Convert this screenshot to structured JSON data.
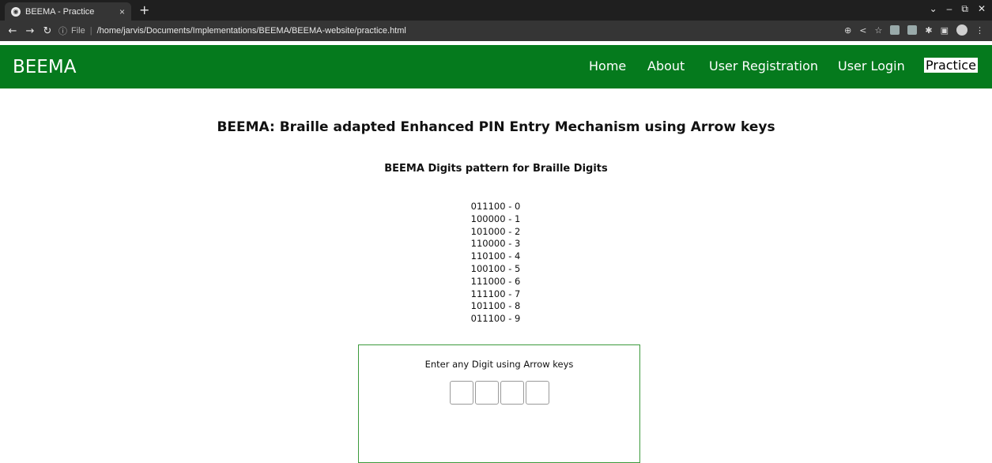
{
  "browser": {
    "tab_title": "BEEMA - Practice",
    "tab_close": "×",
    "new_tab": "+",
    "url_scheme": "File",
    "url": "/home/jarvis/Documents/Implementations/BEEMA/BEEMA-website/practice.html",
    "window_controls": [
      "⌄",
      "–",
      "⧉",
      "✕"
    ]
  },
  "navbar": {
    "brand": "BEEMA",
    "links": [
      {
        "label": "Home",
        "active": false
      },
      {
        "label": "About",
        "active": false
      },
      {
        "label": "User Registration",
        "active": false
      },
      {
        "label": "User Login",
        "active": false
      },
      {
        "label": "Practice",
        "active": true
      }
    ],
    "background_color": "#057a1d"
  },
  "main": {
    "title": "BEEMA: Braille adapted Enhanced PIN Entry Mechanism using Arrow keys",
    "subtitle": "BEEMA Digits pattern for Braille Digits",
    "patterns": [
      "011100 - 0",
      "100000 - 1",
      "101000 - 2",
      "110000 - 3",
      "110100 - 4",
      "100100 - 5",
      "111000 - 6",
      "111100 - 7",
      "101100 - 8",
      "011100 - 9"
    ],
    "practice": {
      "label": "Enter any Digit using Arrow keys",
      "pin_count": 4,
      "border_color": "#3c9a3c"
    }
  }
}
